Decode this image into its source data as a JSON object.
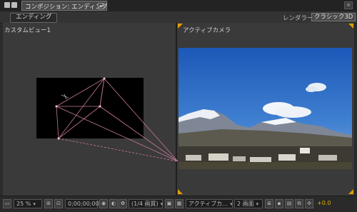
{
  "window": {
    "comp_tab_label": "コンポジション: エンディング",
    "close_glyph": "×",
    "menu_glyph": "≡"
  },
  "subbar": {
    "breadcrumb": "エンディング",
    "renderer_label": "レンダラー：",
    "renderer_value": "クラシック3D"
  },
  "views": {
    "left_title": "カスタムビュー1",
    "right_title": "アクティブカメラ"
  },
  "toolbar": {
    "zoom": "25 %",
    "timecode": "0;00;00;00",
    "resolution": "(1/4 画質)",
    "camera": "アクティブカ…",
    "view_layout": "2 画面",
    "exposure": "+0.0"
  },
  "colors": {
    "camera_lines": "#c8799a",
    "exposure": "#e0b000",
    "corner_marks": "#e0a000"
  }
}
